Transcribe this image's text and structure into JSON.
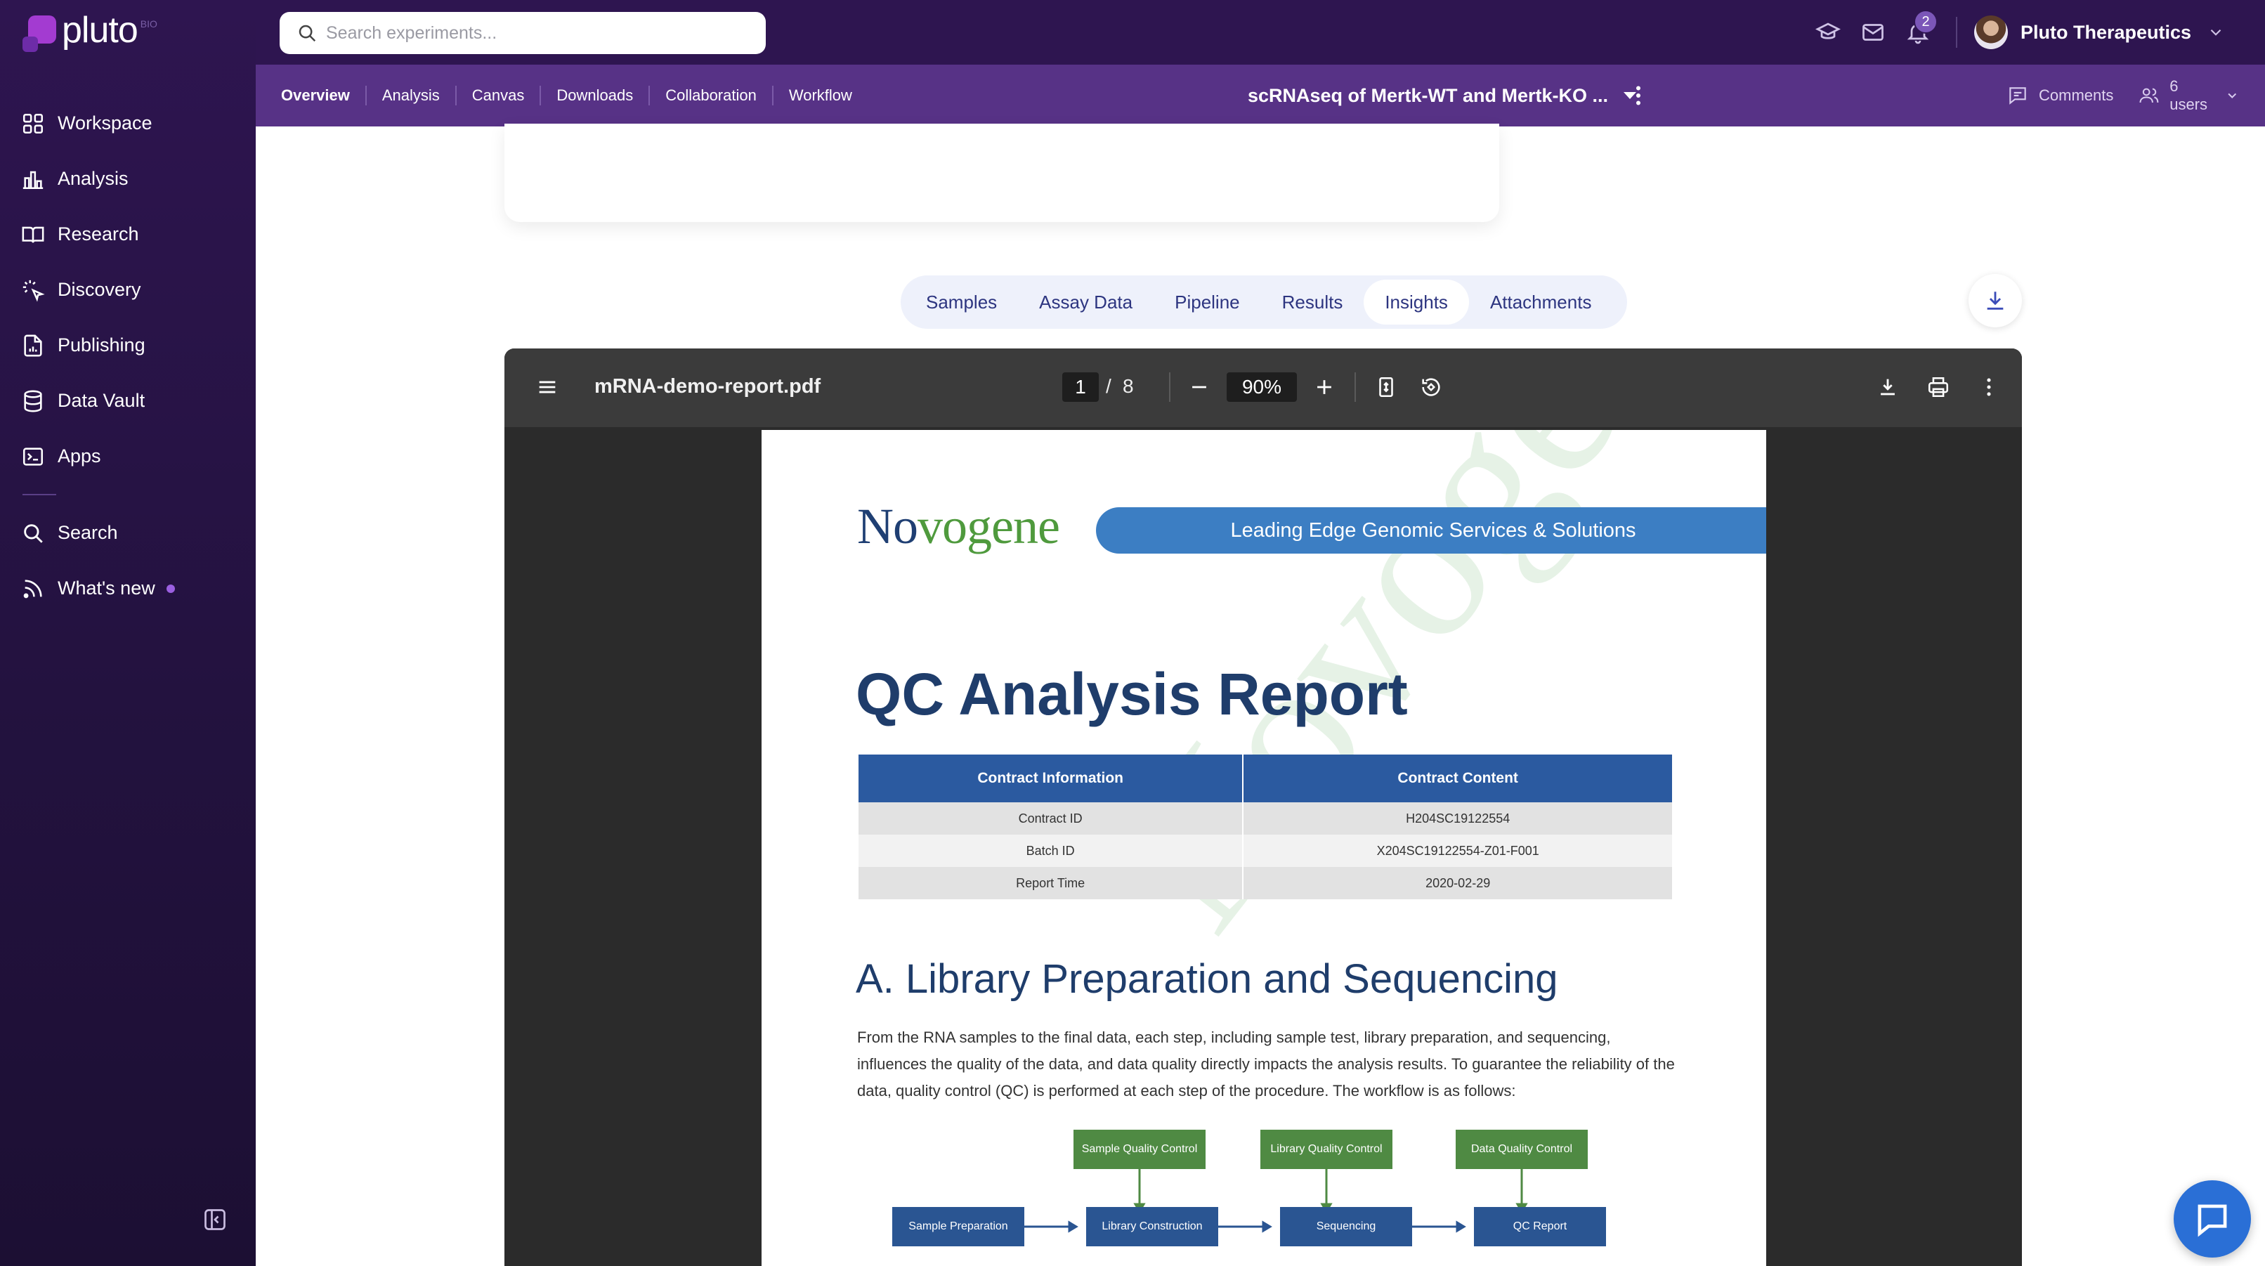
{
  "app": {
    "name": "pluto",
    "superscript": "BIO"
  },
  "sidebar": {
    "items": [
      {
        "label": "Workspace",
        "icon": "grid-icon"
      },
      {
        "label": "Analysis",
        "icon": "bar-chart-icon"
      },
      {
        "label": "Research",
        "icon": "book-icon"
      },
      {
        "label": "Discovery",
        "icon": "sparkle-cursor-icon"
      },
      {
        "label": "Publishing",
        "icon": "document-chart-icon"
      },
      {
        "label": "Data Vault",
        "icon": "database-icon"
      },
      {
        "label": "Apps",
        "icon": "terminal-icon"
      }
    ],
    "secondary": [
      {
        "label": "Search",
        "icon": "search-icon"
      },
      {
        "label": "What's new",
        "icon": "rss-icon"
      }
    ]
  },
  "topbar": {
    "search_placeholder": "Search experiments...",
    "notification_count": "2",
    "org_name": "Pluto Therapeutics"
  },
  "subnav": {
    "tabs": [
      "Overview",
      "Analysis",
      "Canvas",
      "Downloads",
      "Collaboration",
      "Workflow"
    ],
    "experiment_title": "scRNAseq of Mertk-WT and Mertk-KO ...",
    "comments_label": "Comments",
    "users_label": "6 users"
  },
  "content_tabs": {
    "items": [
      "Samples",
      "Assay Data",
      "Pipeline",
      "Results",
      "Insights",
      "Attachments"
    ],
    "active": "Insights"
  },
  "pdf_viewer": {
    "filename": "mRNA-demo-report.pdf",
    "current_page": "1",
    "page_separator": "/",
    "total_pages": "8",
    "zoom": "90%"
  },
  "report": {
    "logo_pre": "N",
    "logo_o": "o",
    "logo_mid": "vo",
    "logo_post": "gene",
    "banner": "Leading Edge Genomic Services & Solutions",
    "title": "QC Analysis Report",
    "watermark": "Novogene",
    "table": {
      "headers": [
        "Contract Information",
        "Contract Content"
      ],
      "rows": [
        [
          "Contract ID",
          "H204SC19122554"
        ],
        [
          "Batch ID",
          "X204SC19122554-Z01-F001"
        ],
        [
          "Report Time",
          "2020-02-29"
        ]
      ]
    },
    "section_title": "A.   Library Preparation and Sequencing",
    "paragraph": "From the RNA samples to the final data, each step, including sample test, library preparation, and sequencing, influences the quality of the data, and data quality directly impacts the analysis results. To guarantee the reliability of the data, quality control (QC) is performed at each step of the procedure. The workflow is as follows:",
    "workflow": {
      "qc_steps": [
        "Sample Quality Control",
        "Library Quality Control",
        "Data Quality Control"
      ],
      "steps": [
        "Sample Preparation",
        "Library Construction",
        "Sequencing",
        "QC Report"
      ]
    }
  },
  "colors": {
    "sidebar_bg": "#2e1550",
    "subnav_bg": "#573286",
    "accent": "#2d3580",
    "pdf_table_header": "#2b5aa0",
    "flow_green": "#4f8a43",
    "flow_blue": "#2a5592"
  }
}
